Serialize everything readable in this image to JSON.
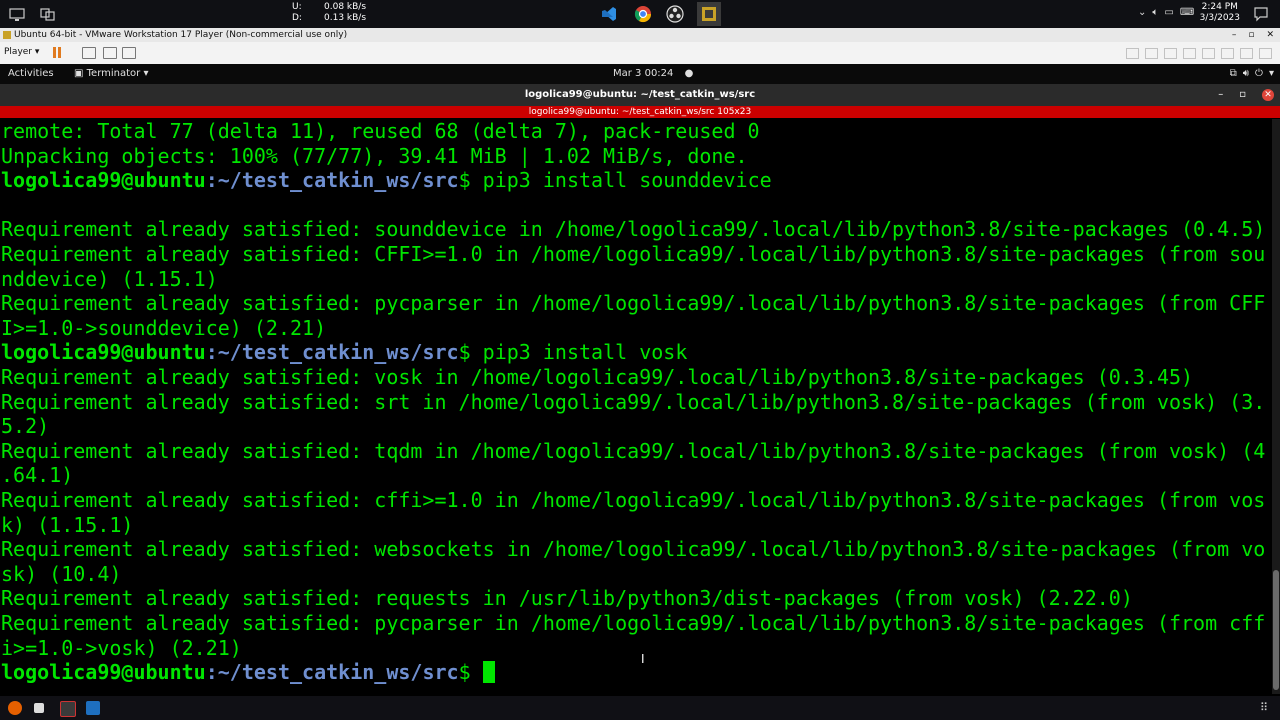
{
  "network": {
    "up_label": "U:",
    "up_value": "0.08 kB/s",
    "down_label": "D:",
    "down_value": "0.13 kB/s"
  },
  "clock": {
    "time": "2:24 PM",
    "date": "3/3/2023"
  },
  "vmware": {
    "window_title": "Ubuntu 64-bit - VMware Workstation 17 Player (Non-commercial use only)",
    "player_menu": "Player"
  },
  "gnome": {
    "activities": "Activities",
    "app_menu": "Terminator",
    "datetime": "Mar 3  00:24"
  },
  "terminator": {
    "title": "logolica99@ubuntu: ~/test_catkin_ws/src",
    "subtitle": "logolica99@ubuntu: ~/test_catkin_ws/src 105x23"
  },
  "terminal": {
    "prompt_user": "logolica99@ubuntu",
    "prompt_path": ":~/test_catkin_ws/src",
    "prompt_symbol": "$ ",
    "lines": [
      {
        "kind": "out",
        "text": "remote: Total 77 (delta 11), reused 68 (delta 7), pack-reused 0"
      },
      {
        "kind": "out",
        "text": "Unpacking objects: 100% (77/77), 39.41 MiB | 1.02 MiB/s, done."
      },
      {
        "kind": "prompt",
        "text": "pip3 install sounddevice"
      },
      {
        "kind": "out",
        "text": ""
      },
      {
        "kind": "out",
        "text": "Requirement already satisfied: sounddevice in /home/logolica99/.local/lib/python3.8/site-packages (0.4.5)"
      },
      {
        "kind": "out",
        "text": "Requirement already satisfied: CFFI>=1.0 in /home/logolica99/.local/lib/python3.8/site-packages (from sou"
      },
      {
        "kind": "out",
        "text": "nddevice) (1.15.1)"
      },
      {
        "kind": "out",
        "text": "Requirement already satisfied: pycparser in /home/logolica99/.local/lib/python3.8/site-packages (from CFF"
      },
      {
        "kind": "out",
        "text": "I>=1.0->sounddevice) (2.21)"
      },
      {
        "kind": "prompt",
        "text": "pip3 install vosk"
      },
      {
        "kind": "out",
        "text": "Requirement already satisfied: vosk in /home/logolica99/.local/lib/python3.8/site-packages (0.3.45)"
      },
      {
        "kind": "out",
        "text": "Requirement already satisfied: srt in /home/logolica99/.local/lib/python3.8/site-packages (from vosk) (3."
      },
      {
        "kind": "out",
        "text": "5.2)"
      },
      {
        "kind": "out",
        "text": "Requirement already satisfied: tqdm in /home/logolica99/.local/lib/python3.8/site-packages (from vosk) (4"
      },
      {
        "kind": "out",
        "text": ".64.1)"
      },
      {
        "kind": "out",
        "text": "Requirement already satisfied: cffi>=1.0 in /home/logolica99/.local/lib/python3.8/site-packages (from vos"
      },
      {
        "kind": "out",
        "text": "k) (1.15.1)"
      },
      {
        "kind": "out",
        "text": "Requirement already satisfied: websockets in /home/logolica99/.local/lib/python3.8/site-packages (from vo"
      },
      {
        "kind": "out",
        "text": "sk) (10.4)"
      },
      {
        "kind": "out",
        "text": "Requirement already satisfied: requests in /usr/lib/python3/dist-packages (from vosk) (2.22.0)"
      },
      {
        "kind": "out",
        "text": "Requirement already satisfied: pycparser in /home/logolica99/.local/lib/python3.8/site-packages (from cff"
      },
      {
        "kind": "out",
        "text": "i>=1.0->vosk) (2.21)"
      },
      {
        "kind": "prompt",
        "text": ""
      }
    ]
  },
  "icons": {
    "windows_top": [
      "desktop-icon",
      "task-view-icon",
      "vscode-icon",
      "chrome-icon",
      "obs-icon",
      "vmware-icon"
    ],
    "tray": [
      "chevron-up-icon",
      "volume-icon",
      "network-icon",
      "keyboard-icon",
      "notification-icon"
    ]
  },
  "colors": {
    "prompt": "#00e600",
    "path": "#6f8fd0",
    "output": "#00e600",
    "subtitle_bar": "#cc0000"
  }
}
